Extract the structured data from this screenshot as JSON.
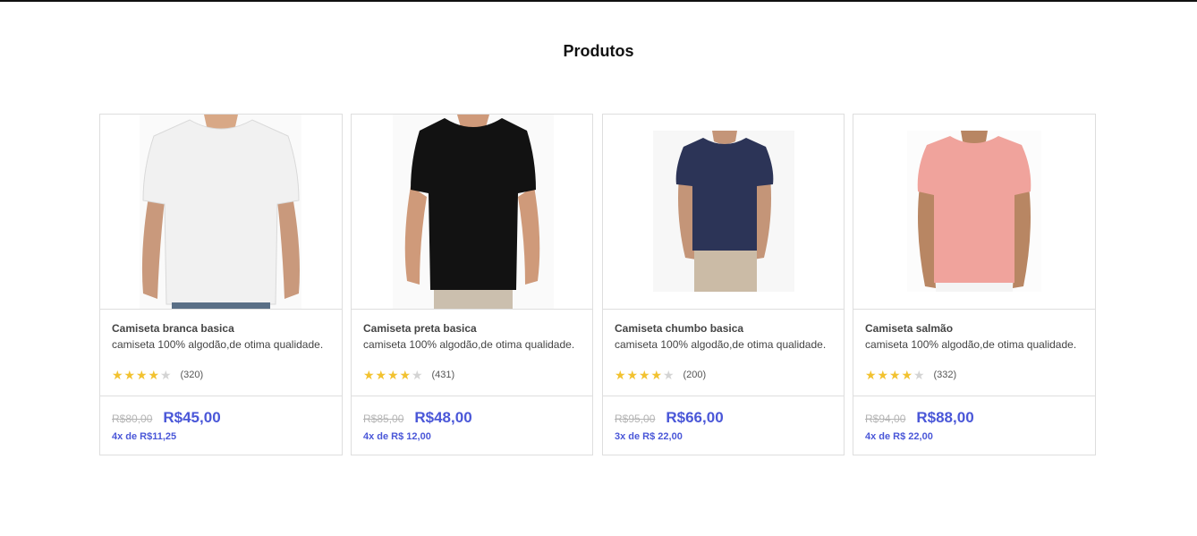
{
  "page": {
    "title": "Produtos"
  },
  "products": [
    {
      "name": "Camiseta branca basica",
      "description": "camiseta 100% algodão,de otima qualidade.",
      "rating": 4,
      "rating_max": 5,
      "reviews": "(320)",
      "old_price": "R$80,00",
      "price": "R$45,00",
      "installments": "4x de R$11,25",
      "shirt_color": "#f1f1f1"
    },
    {
      "name": "Camiseta preta basica",
      "description": "camiseta 100% algodão,de otima qualidade.",
      "rating": 4,
      "rating_max": 5,
      "reviews": "(431)",
      "old_price": "R$85,00",
      "price": "R$48,00",
      "installments": "4x de R$ 12,00",
      "shirt_color": "#121212"
    },
    {
      "name": "Camiseta chumbo basica",
      "description": "camiseta 100% algodão,de otima qualidade.",
      "rating": 4,
      "rating_max": 5,
      "reviews": "(200)",
      "old_price": "R$95,00",
      "price": "R$66,00",
      "installments": "3x de R$ 22,00",
      "shirt_color": "#2c3457"
    },
    {
      "name": "Camiseta salmão",
      "description": "camiseta 100% algodão,de otima qualidade.",
      "rating": 4,
      "rating_max": 5,
      "reviews": "(332)",
      "old_price": "R$94,00",
      "price": "R$88,00",
      "installments": "4x de R$ 22,00",
      "shirt_color": "#f0a39c"
    }
  ]
}
